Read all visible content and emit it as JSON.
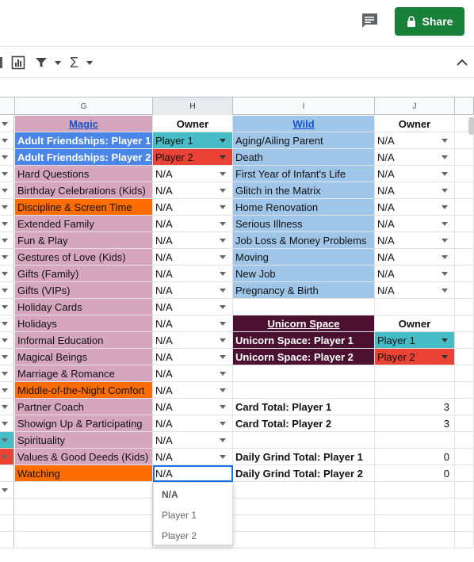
{
  "header": {
    "share_label": "Share"
  },
  "columns": [
    {
      "id": "G",
      "selected": false
    },
    {
      "id": "H",
      "selected": true
    },
    {
      "id": "I",
      "selected": false
    },
    {
      "id": "J",
      "selected": false
    }
  ],
  "colors": {
    "pink": "#d5a6bd",
    "orange": "#ff6d01",
    "blue": "#4a86e8",
    "teal": "#46bdc6",
    "red": "#ea4335",
    "light_blue": "#9fc5e8",
    "dark_purple": "#4c1130",
    "share_green": "#188038"
  },
  "rows": [
    {
      "g": "Magic",
      "g_style": "header",
      "h": "Owner",
      "h_style": "header",
      "i": "Wild",
      "i_style": "header",
      "j": "Owner",
      "j_style": "header"
    },
    {
      "g": "Adult Friendships: Player 1",
      "g_style": "blue",
      "h": "Player 1",
      "h_style": "teal",
      "i": "Aging/Ailing Parent",
      "i_style": "lightblue",
      "j": "N/A",
      "j_style": "dropdown"
    },
    {
      "g": "Adult Friendships: Player 2",
      "g_style": "blue",
      "h": "Player 2",
      "h_style": "red",
      "i": "Death",
      "i_style": "lightblue",
      "j": "N/A",
      "j_style": "dropdown"
    },
    {
      "g": "Hard Questions",
      "g_style": "pink",
      "h": "N/A",
      "h_style": "dropdown",
      "i": "First Year of Infant's Life",
      "i_style": "lightblue",
      "j": "N/A",
      "j_style": "dropdown"
    },
    {
      "g": "Birthday Celebrations (Kids)",
      "g_style": "pink",
      "h": "N/A",
      "h_style": "dropdown",
      "i": "Glitch in the Matrix",
      "i_style": "lightblue",
      "j": "N/A",
      "j_style": "dropdown"
    },
    {
      "g": "Discipline & Screen Time",
      "g_style": "orange",
      "h": "N/A",
      "h_style": "dropdown",
      "i": "Home Renovation",
      "i_style": "lightblue",
      "j": "N/A",
      "j_style": "dropdown"
    },
    {
      "g": "Extended Family",
      "g_style": "pink",
      "h": "N/A",
      "h_style": "dropdown",
      "i": "Serious Illness",
      "i_style": "lightblue",
      "j": "N/A",
      "j_style": "dropdown"
    },
    {
      "g": "Fun & Play",
      "g_style": "pink",
      "h": "N/A",
      "h_style": "dropdown",
      "i": "Job Loss & Money Problems",
      "i_style": "lightblue",
      "j": "N/A",
      "j_style": "dropdown"
    },
    {
      "g": "Gestures of Love (Kids)",
      "g_style": "pink",
      "h": "N/A",
      "h_style": "dropdown",
      "i": "Moving",
      "i_style": "lightblue",
      "j": "N/A",
      "j_style": "dropdown"
    },
    {
      "g": "Gifts (Family)",
      "g_style": "pink",
      "h": "N/A",
      "h_style": "dropdown",
      "i": "New Job",
      "i_style": "lightblue",
      "j": "N/A",
      "j_style": "dropdown"
    },
    {
      "g": "Gifts (VIPs)",
      "g_style": "pink",
      "h": "N/A",
      "h_style": "dropdown",
      "i": "Pregnancy & Birth",
      "i_style": "lightblue",
      "j": "N/A",
      "j_style": "dropdown"
    },
    {
      "g": "Holiday Cards",
      "g_style": "pink",
      "h": "N/A",
      "h_style": "dropdown",
      "i": "",
      "i_style": "plain",
      "j": "",
      "j_style": "plain"
    },
    {
      "g": "Holidays",
      "g_style": "pink",
      "h": "N/A",
      "h_style": "dropdown",
      "i": "Unicorn Space",
      "i_style": "unicornheader",
      "j": "Owner",
      "j_style": "header"
    },
    {
      "g": "Informal Education",
      "g_style": "pink",
      "h": "N/A",
      "h_style": "dropdown",
      "i": "Unicorn Space: Player 1",
      "i_style": "purple",
      "j": "Player 1",
      "j_style": "teal"
    },
    {
      "g": "Magical Beings",
      "g_style": "pink",
      "h": "N/A",
      "h_style": "dropdown",
      "i": "Unicorn Space: Player 2",
      "i_style": "purple",
      "j": "Player 2",
      "j_style": "red"
    },
    {
      "g": "Marriage & Romance",
      "g_style": "pink",
      "h": "N/A",
      "h_style": "dropdown",
      "i": "",
      "i_style": "plain",
      "j": "",
      "j_style": "plain"
    },
    {
      "g": "Middle-of-the-Night Comfort",
      "g_style": "orange",
      "h": "N/A",
      "h_style": "dropdown",
      "i": "",
      "i_style": "plain",
      "j": "",
      "j_style": "plain"
    },
    {
      "g": "Partner Coach",
      "g_style": "pink",
      "h": "N/A",
      "h_style": "dropdown",
      "i": "Card Total: Player 1",
      "i_style": "bold",
      "j": "3",
      "j_style": "number"
    },
    {
      "g": "Showign Up & Participating",
      "g_style": "pink",
      "h": "N/A",
      "h_style": "dropdown",
      "i": "Card Total: Player 2",
      "i_style": "bold",
      "j": "3",
      "j_style": "number"
    },
    {
      "g": "Spirituality",
      "g_style": "pink",
      "h": "N/A",
      "h_style": "dropdown",
      "i": "",
      "i_style": "plain",
      "j": "",
      "j_style": "plain"
    },
    {
      "g": "Values & Good Deeds (Kids)",
      "g_style": "pink",
      "h": "N/A",
      "h_style": "dropdown",
      "i": "Daily Grind Total: Player 1",
      "i_style": "bold",
      "j": "0",
      "j_style": "number"
    },
    {
      "g": "Watching",
      "g_style": "orange",
      "h": "N/A",
      "h_style": "selected",
      "i": "Daily Grind Total: Player 2",
      "i_style": "bold",
      "j": "0",
      "j_style": "number"
    }
  ],
  "gutter": [
    "",
    "",
    "",
    "",
    "",
    "",
    "",
    "",
    "",
    "",
    "",
    "",
    "",
    "",
    "",
    "",
    "",
    "",
    "",
    "teal",
    "red",
    ""
  ],
  "dropdown_options": [
    "N/A",
    "Player 1",
    "Player 2"
  ]
}
